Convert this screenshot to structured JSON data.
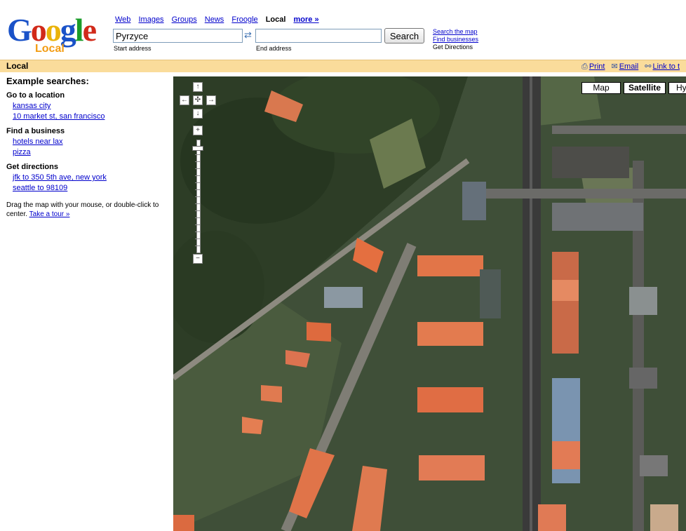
{
  "logo": {
    "word": "Google",
    "sub": "Local"
  },
  "tabs": [
    "Web",
    "Images",
    "Groups",
    "News",
    "Froogle"
  ],
  "current_tab": "Local",
  "more": "more »",
  "search": {
    "start_value": "Pyrzyce",
    "start_label": "Start address",
    "end_value": "",
    "end_label": "End address",
    "button": "Search"
  },
  "right_links": {
    "search_map": "Search the map",
    "find_businesses": "Find businesses",
    "get_directions": "Get Directions"
  },
  "bar": {
    "title": "Local",
    "print": "Print",
    "email": "Email",
    "link": "Link to t"
  },
  "sidebar": {
    "heading": "Example searches:",
    "groups": [
      {
        "title": "Go to a location",
        "items": [
          "kansas city",
          "10 market st, san francisco"
        ]
      },
      {
        "title": "Find a business",
        "items": [
          "hotels near lax",
          "pizza"
        ]
      },
      {
        "title": "Get directions",
        "items": [
          "jfk to 350 5th ave, new york",
          "seattle to 98109"
        ]
      }
    ],
    "help_text": "Drag the map with your mouse, or double-click to center.",
    "tour_link": "Take a tour »"
  },
  "map_types": {
    "map": "Map",
    "satellite": "Satellite",
    "hybrid": "Hy"
  },
  "controls": {
    "up": "↑",
    "left": "←",
    "center": "✣",
    "right": "→",
    "down": "↓",
    "zoom_in": "+",
    "zoom_out": "−"
  },
  "icons": {
    "print": "printer-icon",
    "email": "envelope-icon",
    "link": "chain-link-icon",
    "swap": "swap-arrows-icon"
  }
}
